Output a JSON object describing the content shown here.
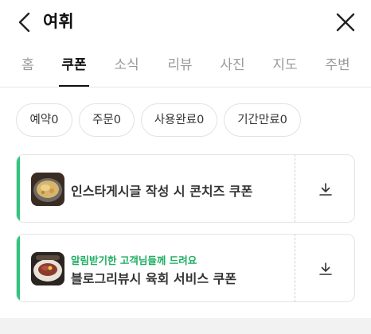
{
  "header": {
    "title": "여휘",
    "back_icon": "chevron-left-icon",
    "close_icon": "close-icon"
  },
  "tabs": [
    {
      "label": "홈",
      "active": false
    },
    {
      "label": "쿠폰",
      "active": true
    },
    {
      "label": "소식",
      "active": false
    },
    {
      "label": "리뷰",
      "active": false
    },
    {
      "label": "사진",
      "active": false
    },
    {
      "label": "지도",
      "active": false
    },
    {
      "label": "주변",
      "active": false
    }
  ],
  "filters": [
    {
      "label": "예약0"
    },
    {
      "label": "주문0"
    },
    {
      "label": "사용완료0"
    },
    {
      "label": "기간만료0"
    }
  ],
  "coupons": [
    {
      "subtitle": "",
      "title": "인스타게시글 작성 시 콘치즈 쿠폰",
      "download_icon": "download-icon"
    },
    {
      "subtitle": "알림받기한 고객님들께 드려요",
      "title": "블로그리뷰시 육회 서비스 쿠폰",
      "download_icon": "download-icon"
    }
  ],
  "colors": {
    "accent": "#2fc67d",
    "subtitle": "#1fae62",
    "active_tab": "#111111",
    "inactive_tab": "#9a9a9a"
  }
}
